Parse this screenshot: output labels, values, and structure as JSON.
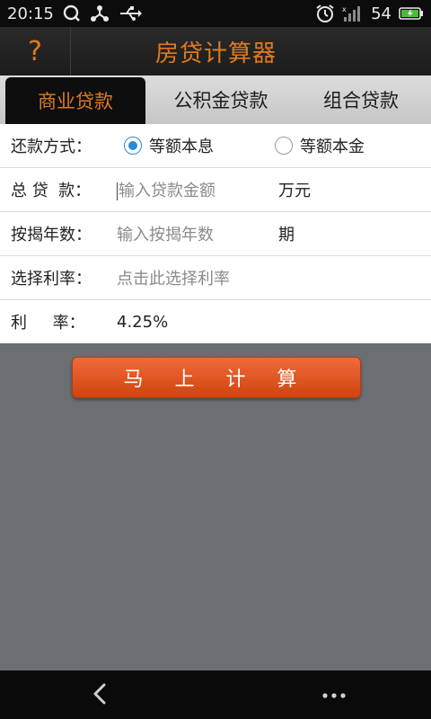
{
  "status_bar": {
    "time": "20:15",
    "battery": "54",
    "icons": [
      "q-icon",
      "share-icon",
      "usb-icon",
      "alarm-icon",
      "signal-icon",
      "battery-icon"
    ]
  },
  "title_bar": {
    "help_label": "?",
    "title": "房贷计算器"
  },
  "tabs": [
    {
      "label": "商业贷款",
      "active": true
    },
    {
      "label": "公积金贷款",
      "active": false
    },
    {
      "label": "组合贷款",
      "active": false
    }
  ],
  "form": {
    "repayment": {
      "label": "还款方式：",
      "options": [
        {
          "label": "等额本息",
          "checked": true
        },
        {
          "label": "等额本金",
          "checked": false
        }
      ]
    },
    "loan_amount": {
      "label": "总 贷  款：",
      "placeholder": "输入贷款金额",
      "unit": "万元"
    },
    "mortgage_years": {
      "label": "按揭年数：",
      "placeholder": "输入按揭年数",
      "unit": "期"
    },
    "rate_select": {
      "label": "选择利率：",
      "placeholder": "点击此选择利率"
    },
    "rate": {
      "label": "利     率：",
      "value": "4.25%"
    }
  },
  "calculate_button": "马 上 计 算",
  "colors": {
    "accent": "#e07a1e",
    "button": "#e0551c",
    "radio": "#2a8bd6",
    "background": "#6b6e72"
  }
}
